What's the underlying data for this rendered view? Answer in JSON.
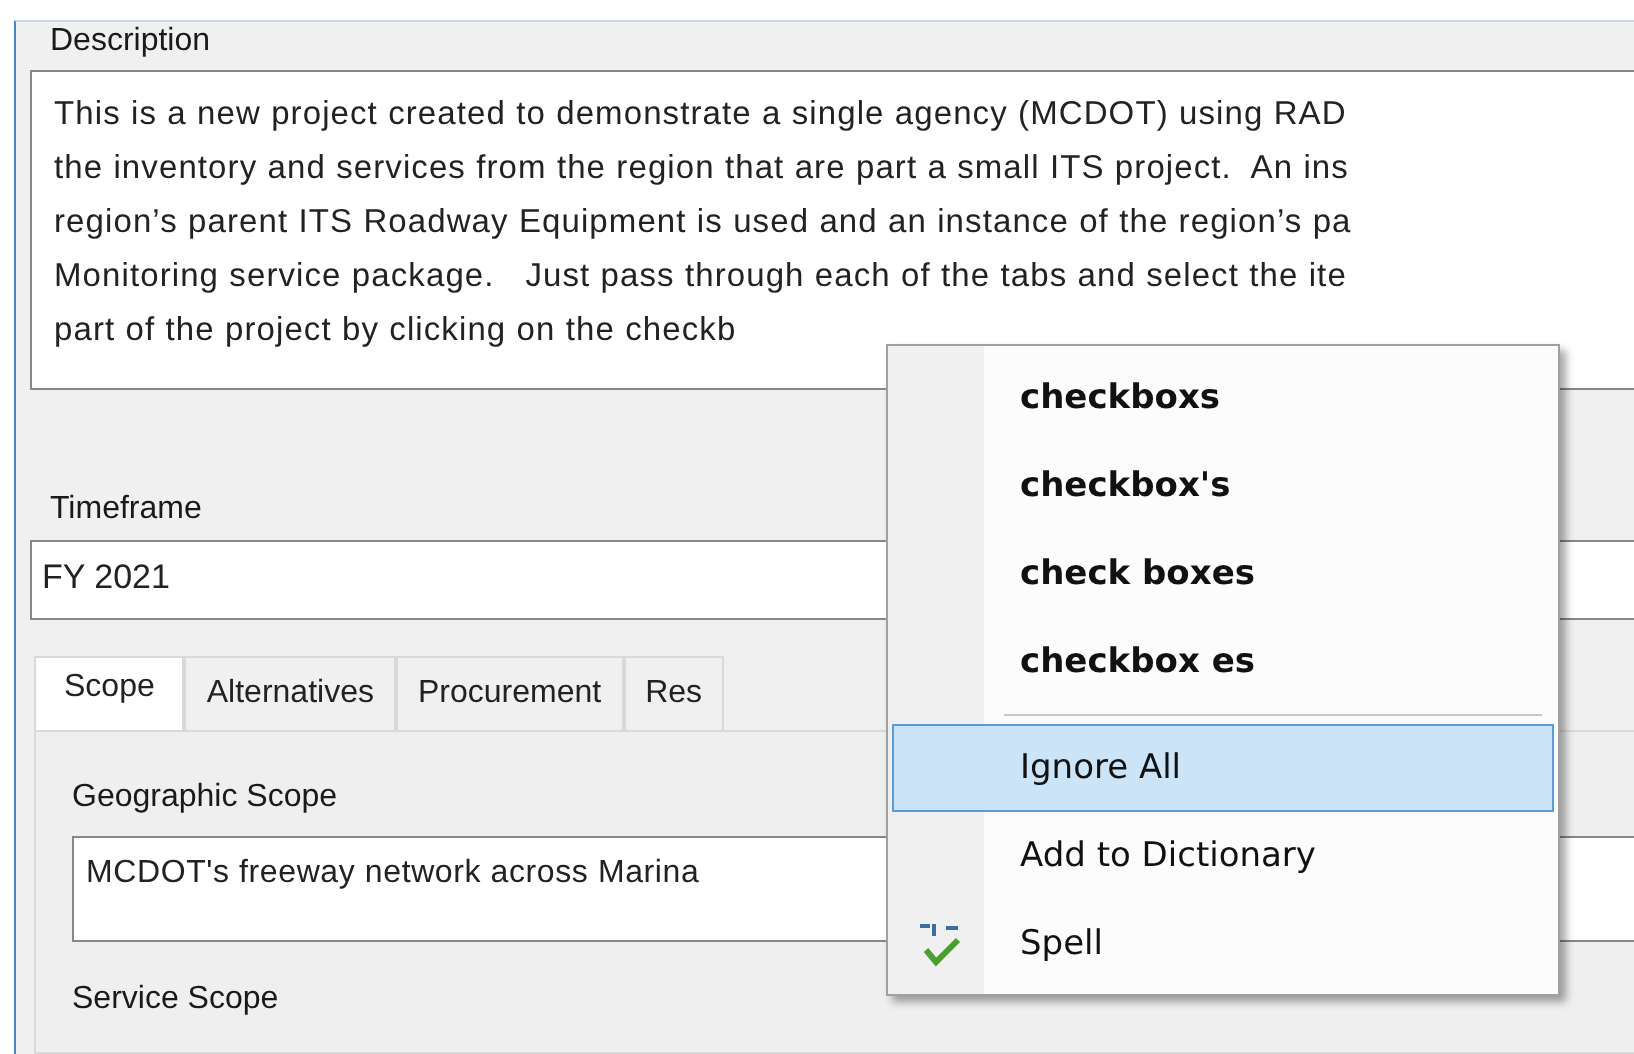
{
  "description": {
    "label": "Description",
    "lines": [
      "This is a new project created to demonstrate a single agency (MCDOT) using RAD",
      "the inventory and services from the region that are part a small ITS project.  An ins",
      "region’s parent ITS Roadway Equipment is used and an instance of the region’s pa",
      "Monitoring service package.   Just pass through each of the tabs and select the ite",
      "part of the project by clicking on the checkb"
    ]
  },
  "timeframe": {
    "label": "Timeframe",
    "value": "FY 2021"
  },
  "tabs": [
    {
      "label": "Scope",
      "selected": true
    },
    {
      "label": "Alternatives",
      "selected": false
    },
    {
      "label": "Procurement",
      "selected": false
    },
    {
      "label": "Res",
      "selected": false
    }
  ],
  "geographic_scope": {
    "label": "Geographic Scope",
    "value": "MCDOT's freeway network across Marina"
  },
  "service_scope": {
    "label": "Service Scope"
  },
  "context_menu": {
    "suggestions": [
      "checkboxs",
      "checkbox's",
      "check boxes",
      "checkbox es"
    ],
    "items": [
      {
        "label": "Ignore All",
        "kind": "plain",
        "selected": true
      },
      {
        "label": "Add to Dictionary",
        "kind": "plain",
        "selected": false
      },
      {
        "label": "Spell",
        "kind": "spell",
        "selected": false
      }
    ]
  }
}
